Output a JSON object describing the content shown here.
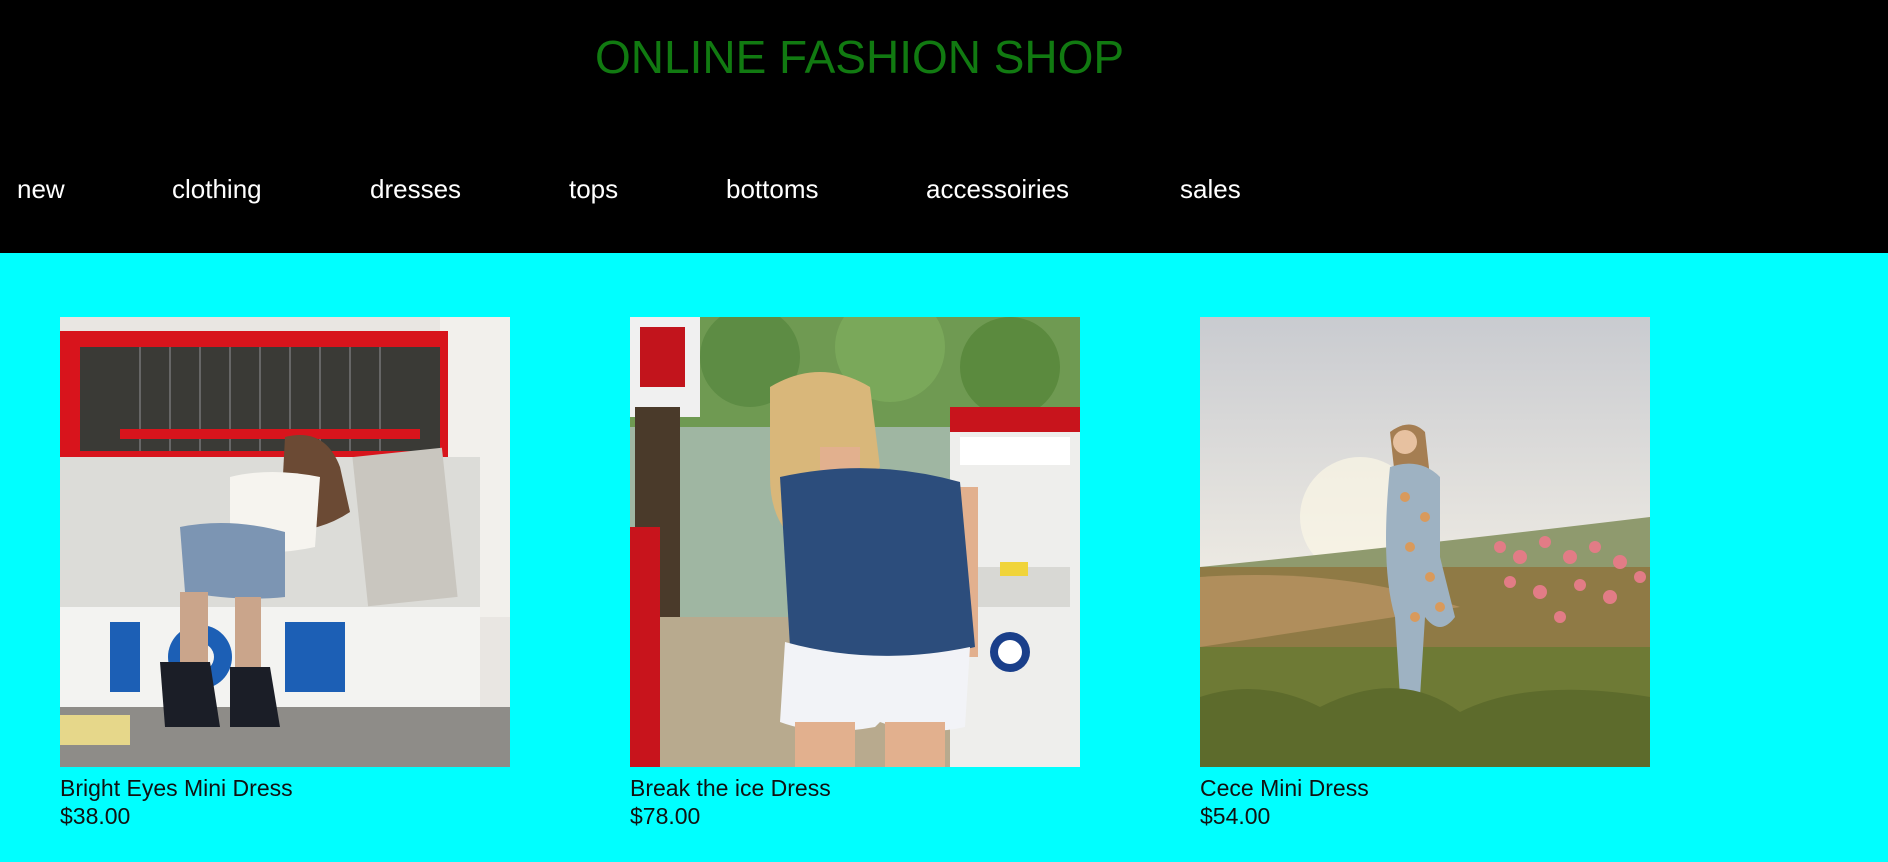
{
  "header": {
    "title": "ONLINE FASHION SHOP",
    "title_color": "#117a11",
    "background": "#000000"
  },
  "nav": {
    "items": [
      {
        "label": "new"
      },
      {
        "label": "clothing"
      },
      {
        "label": "dresses"
      },
      {
        "label": "tops"
      },
      {
        "label": "bottoms"
      },
      {
        "label": "accessoiries"
      },
      {
        "label": "sales"
      }
    ]
  },
  "page": {
    "background": "#00ffff"
  },
  "products": [
    {
      "name": "Bright Eyes Mini Dress",
      "price": "$38.00",
      "image": "photo of woman in white lace top and denim shorts leaning into an ice chest"
    },
    {
      "name": "Break the ice Dress",
      "price": "$78.00",
      "image": "photo of blonde woman in denim top and white shorts at gas pump"
    },
    {
      "name": "Cece Mini Dress",
      "price": "$54.00",
      "image": "photo of woman in floral outfit standing in flower field at sunset"
    }
  ]
}
